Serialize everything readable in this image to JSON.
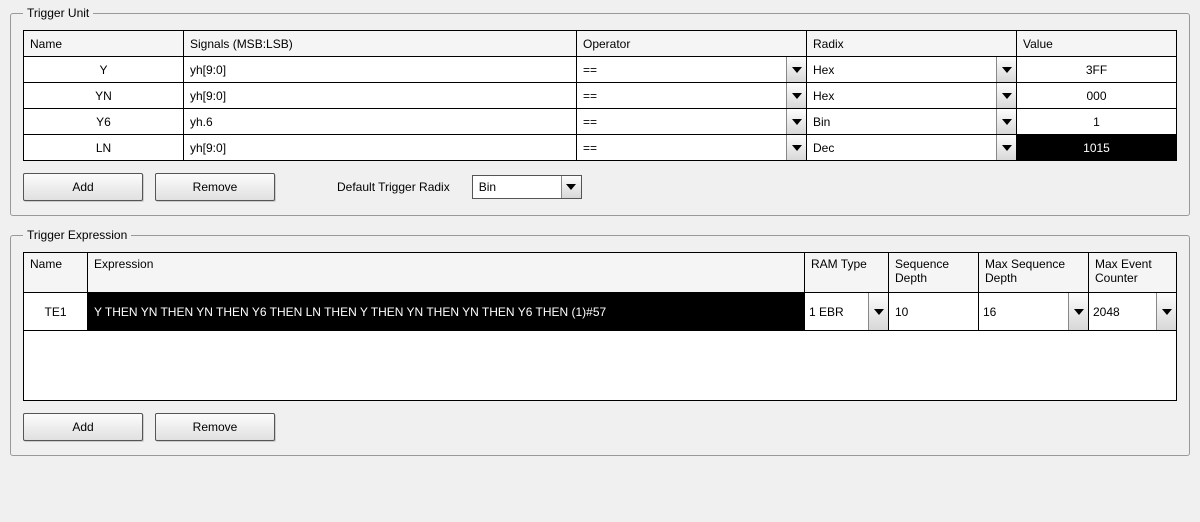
{
  "trigger_unit": {
    "legend": "Trigger Unit",
    "headers": {
      "name": "Name",
      "signals": "Signals (MSB:LSB)",
      "operator": "Operator",
      "radix": "Radix",
      "value": "Value"
    },
    "rows": [
      {
        "name": "Y",
        "signals": "yh[9:0]",
        "operator": "==",
        "radix": "Hex",
        "value": "3FF",
        "highlight": false
      },
      {
        "name": "YN",
        "signals": "yh[9:0]",
        "operator": "==",
        "radix": "Hex",
        "value": "000",
        "highlight": false
      },
      {
        "name": "Y6",
        "signals": "yh.6",
        "operator": "==",
        "radix": "Bin",
        "value": "1",
        "highlight": false
      },
      {
        "name": "LN",
        "signals": "yh[9:0]",
        "operator": "==",
        "radix": "Dec",
        "value": "1015",
        "highlight": true
      }
    ],
    "buttons": {
      "add": "Add",
      "remove": "Remove"
    },
    "default_radix_label": "Default Trigger Radix",
    "default_radix_value": "Bin"
  },
  "trigger_expression": {
    "legend": "Trigger Expression",
    "headers": {
      "name": "Name",
      "expression": "Expression",
      "ram_type": "RAM Type",
      "seq_depth": "Sequence Depth",
      "max_seq_depth": "Max Sequence Depth",
      "max_event_counter": "Max Event Counter"
    },
    "rows": [
      {
        "name": "TE1",
        "expression": "Y THEN YN THEN YN THEN Y6 THEN LN THEN Y THEN YN THEN YN THEN Y6 THEN (1)#57",
        "ram_type": "1 EBR",
        "seq_depth": "10",
        "max_seq_depth": "16",
        "max_event_counter": "2048"
      }
    ],
    "buttons": {
      "add": "Add",
      "remove": "Remove"
    }
  }
}
